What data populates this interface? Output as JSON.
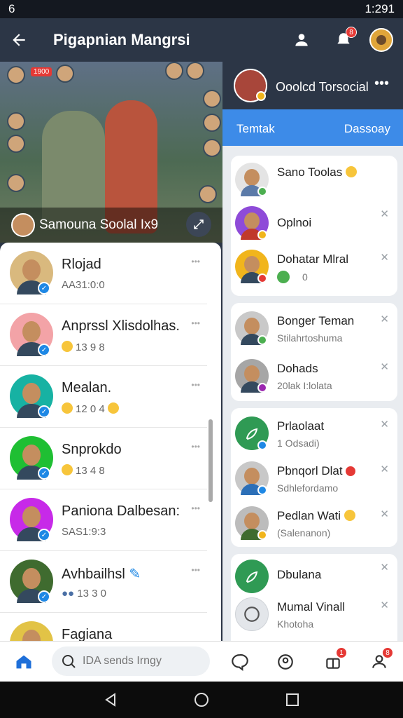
{
  "status_bar": {
    "left": "6",
    "time": "1:291"
  },
  "header": {
    "title": "Pigapnian Mangrsi",
    "notif_count": "8"
  },
  "video": {
    "caption": "Samouna Soolal Ix9",
    "tag": "1900"
  },
  "left_list": {
    "items": [
      {
        "name": "Rlojad",
        "sub": "AA31:0:0",
        "color": "#d9b97e"
      },
      {
        "name": "Anprssl Xlisdolhas.",
        "sub": "13 9 8",
        "color": "#f3a3a7"
      },
      {
        "name": "Mealan.",
        "sub": "12 0 4",
        "color": "#17b2a3"
      },
      {
        "name": "Snprokdo",
        "sub": "13 4 8",
        "color": "#1fbf33"
      },
      {
        "name": "Paniona Dalbesan:",
        "sub": "SAS1:9:3",
        "color": "#c72ae8"
      },
      {
        "name": "Avhbailhsl",
        "sub": "13 3 0",
        "color": "#3f6b2f"
      },
      {
        "name": "Fagiana",
        "sub": "",
        "color": "#e2c346"
      }
    ]
  },
  "right_panel": {
    "header_title": "Ooolcd Torsocial",
    "tab_left": "Temtak",
    "tab_right": "Dassoay",
    "cards": [
      {
        "rows": [
          {
            "name": "Sano Toolas",
            "sub": "",
            "color": "#e4e4e4"
          },
          {
            "name": "Oplnoi",
            "sub": "",
            "color": "#8e4bd8"
          },
          {
            "name": "Dohatar Mlral",
            "sub": "0",
            "color": "#f1b51c"
          }
        ]
      },
      {
        "rows": [
          {
            "name": "Bonger Teman",
            "sub": "Stilahrtoshuma",
            "color": "#c9c9c9"
          },
          {
            "name": "Dohads",
            "sub": "20lak I:lolata",
            "color": "#a6a6a6"
          }
        ]
      },
      {
        "rows": [
          {
            "name": "Prlaolaat",
            "sub": "1 Odsadi)",
            "color": "#2f9a54"
          },
          {
            "name": "Pbnqorl Dlat",
            "sub": "Sdhlefordamo",
            "color": "#c8c8c8"
          },
          {
            "name": "Pedlan Wati",
            "sub": "(Salenanon)",
            "color": "#bcbcbc"
          }
        ]
      },
      {
        "rows": [
          {
            "name": "Dbulana",
            "sub": "",
            "color": "#2f9a54"
          },
          {
            "name": "Mumal Vinall",
            "sub": "Khotoha",
            "color": "#e3e6ea"
          }
        ]
      }
    ]
  },
  "bottom_nav": {
    "search_placeholder": "IDA sends Irngy",
    "badge1": "1",
    "badge2": "8"
  },
  "colors": {
    "accent": "#3d8be8",
    "header": "#2c3646",
    "verified": "#1e88e5"
  }
}
